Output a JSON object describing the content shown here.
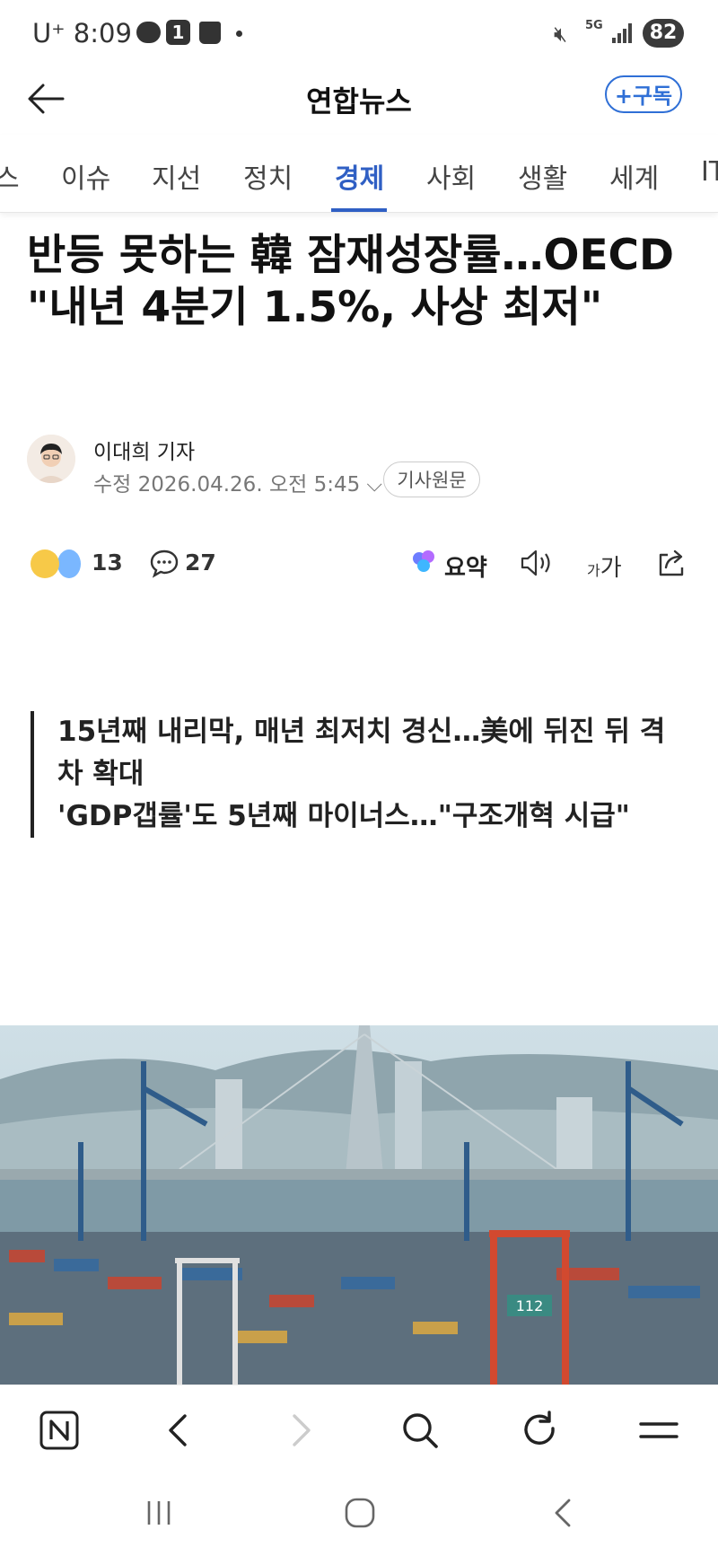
{
  "status_bar": {
    "carrier": "U⁺",
    "time": "8:09",
    "notification_count": "1",
    "network": "5G",
    "battery": "82"
  },
  "header": {
    "brand": "연합뉴스",
    "subscribe_label": "+구독"
  },
  "tabs": [
    {
      "label": "스"
    },
    {
      "label": "이슈"
    },
    {
      "label": "지선"
    },
    {
      "label": "정치"
    },
    {
      "label": "경제"
    },
    {
      "label": "사회"
    },
    {
      "label": "생활"
    },
    {
      "label": "세계"
    },
    {
      "label": "IT"
    }
  ],
  "active_tab": "경제",
  "article": {
    "title": "반등 못하는 韓 잠재성장률…OECD \"내년 4분기 1.5%, 사상 최저\"",
    "reporter": "이대희 기자",
    "modified": "수정 2026.04.26. 오전 5:45",
    "original_label": "기사원문",
    "reaction_count": "13",
    "comment_count": "27",
    "summary_label": "요약",
    "font_size_small": "가",
    "font_size_large": "가",
    "subheadlines": [
      "15년째 내리막, 매년 최저치 경신…美에 뒤진 뒤 격차 확대",
      "'GDP갭률'도 5년째 마이너스…\"구조개혁 시급\""
    ],
    "photo_label": "112"
  },
  "colors": {
    "accent": "#2f5fc4",
    "subscribe": "#2f6fd6"
  }
}
